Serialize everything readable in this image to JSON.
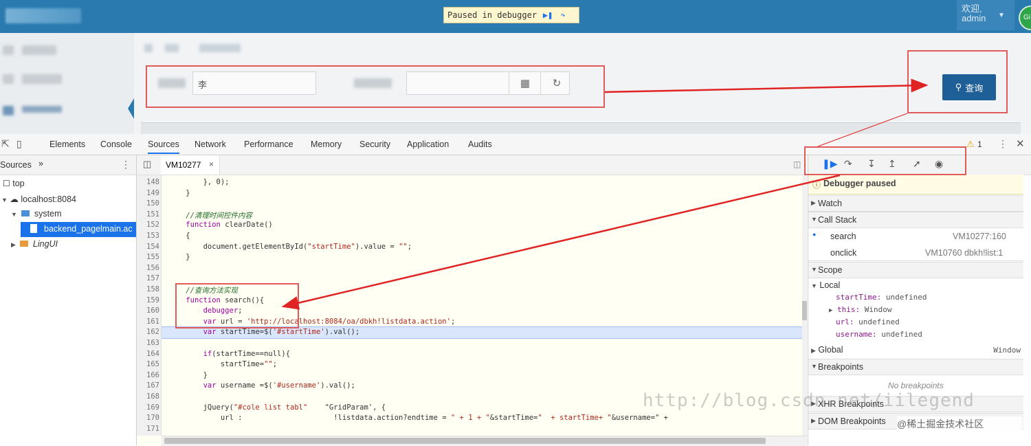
{
  "app": {
    "paused_text": "Paused in debugger",
    "user": {
      "greeting": "欢迎,",
      "name": "admin"
    },
    "avatar_text": "Gi",
    "search_value": "李",
    "query_button": "查询"
  },
  "devtools": {
    "tabs": [
      "Elements",
      "Console",
      "Sources",
      "Network",
      "Performance",
      "Memory",
      "Security",
      "Application",
      "Audits"
    ],
    "active_tab": "Sources",
    "warning_count": "1",
    "navigator": {
      "tab": "Sources",
      "more": "»",
      "items": [
        "top",
        "localhost:8084",
        "system",
        "backend_pagelmain.ac",
        "LingUI"
      ]
    },
    "editor": {
      "file_tab": "VM10277",
      "lines": [
        {
          "n": "148",
          "t": "        }, 0);"
        },
        {
          "n": "149",
          "t": "    }"
        },
        {
          "n": "150",
          "t": ""
        },
        {
          "n": "151",
          "t": "    //清理时间控件内容"
        },
        {
          "n": "152",
          "t": "    function clearDate()"
        },
        {
          "n": "153",
          "t": "    {"
        },
        {
          "n": "154",
          "t": "        document.getElementById(\"startTime\").value = \"\";"
        },
        {
          "n": "155",
          "t": "    }"
        },
        {
          "n": "156",
          "t": ""
        },
        {
          "n": "157",
          "t": ""
        },
        {
          "n": "158",
          "t": "    //查询方法实现"
        },
        {
          "n": "159",
          "t": "    function search(){"
        },
        {
          "n": "160",
          "t": "        debugger;"
        },
        {
          "n": "161",
          "t": "        var url = 'http://localhost:8084/oa/dbkh!listdata.action';"
        },
        {
          "n": "162",
          "t": "        var startTime=$('#startTime').val();"
        },
        {
          "n": "163",
          "t": ""
        },
        {
          "n": "164",
          "t": "        if(startTime==null){"
        },
        {
          "n": "165",
          "t": "            startTime=\"\";"
        },
        {
          "n": "166",
          "t": "        }"
        },
        {
          "n": "167",
          "t": "        var username =$('#username').val();"
        },
        {
          "n": "168",
          "t": ""
        },
        {
          "n": "169",
          "t": "        jQuery(\"#cole list tabl\"    \"GridParam', {"
        },
        {
          "n": "170",
          "t": "            url :                     !listdata.action?endtime = \" + 1 + \"&startTime=\"  + startTime+ \"&username=\" +"
        },
        {
          "n": "171",
          "t": ""
        }
      ]
    },
    "debugger": {
      "status": "Debugger paused",
      "watch": "Watch",
      "call_stack": "Call Stack",
      "frames": [
        {
          "name": "search",
          "loc": "VM10277:160"
        },
        {
          "name": "onclick",
          "loc": "VM10760 dbkh!list:1"
        }
      ],
      "scope": "Scope",
      "local": "Local",
      "vars": [
        {
          "k": "startTime:",
          "v": "undefined"
        },
        {
          "k": "this:",
          "v": "Window"
        },
        {
          "k": "url:",
          "v": "undefined"
        },
        {
          "k": "username:",
          "v": "undefined"
        }
      ],
      "global": "Global",
      "global_value": "Window",
      "breakpoints": "Breakpoints",
      "no_breakpoints": "No breakpoints",
      "xhr": "XHR Breakpoints",
      "dom": "DOM Breakpoints"
    }
  },
  "overlays": {
    "watermark": "http://blog.csdn.net/iilegend",
    "credit": "@稀土掘金技术社区"
  },
  "colors": {
    "annotation": "#e02424",
    "accent": "#1a73e8",
    "appbar": "#2a7ab0"
  }
}
